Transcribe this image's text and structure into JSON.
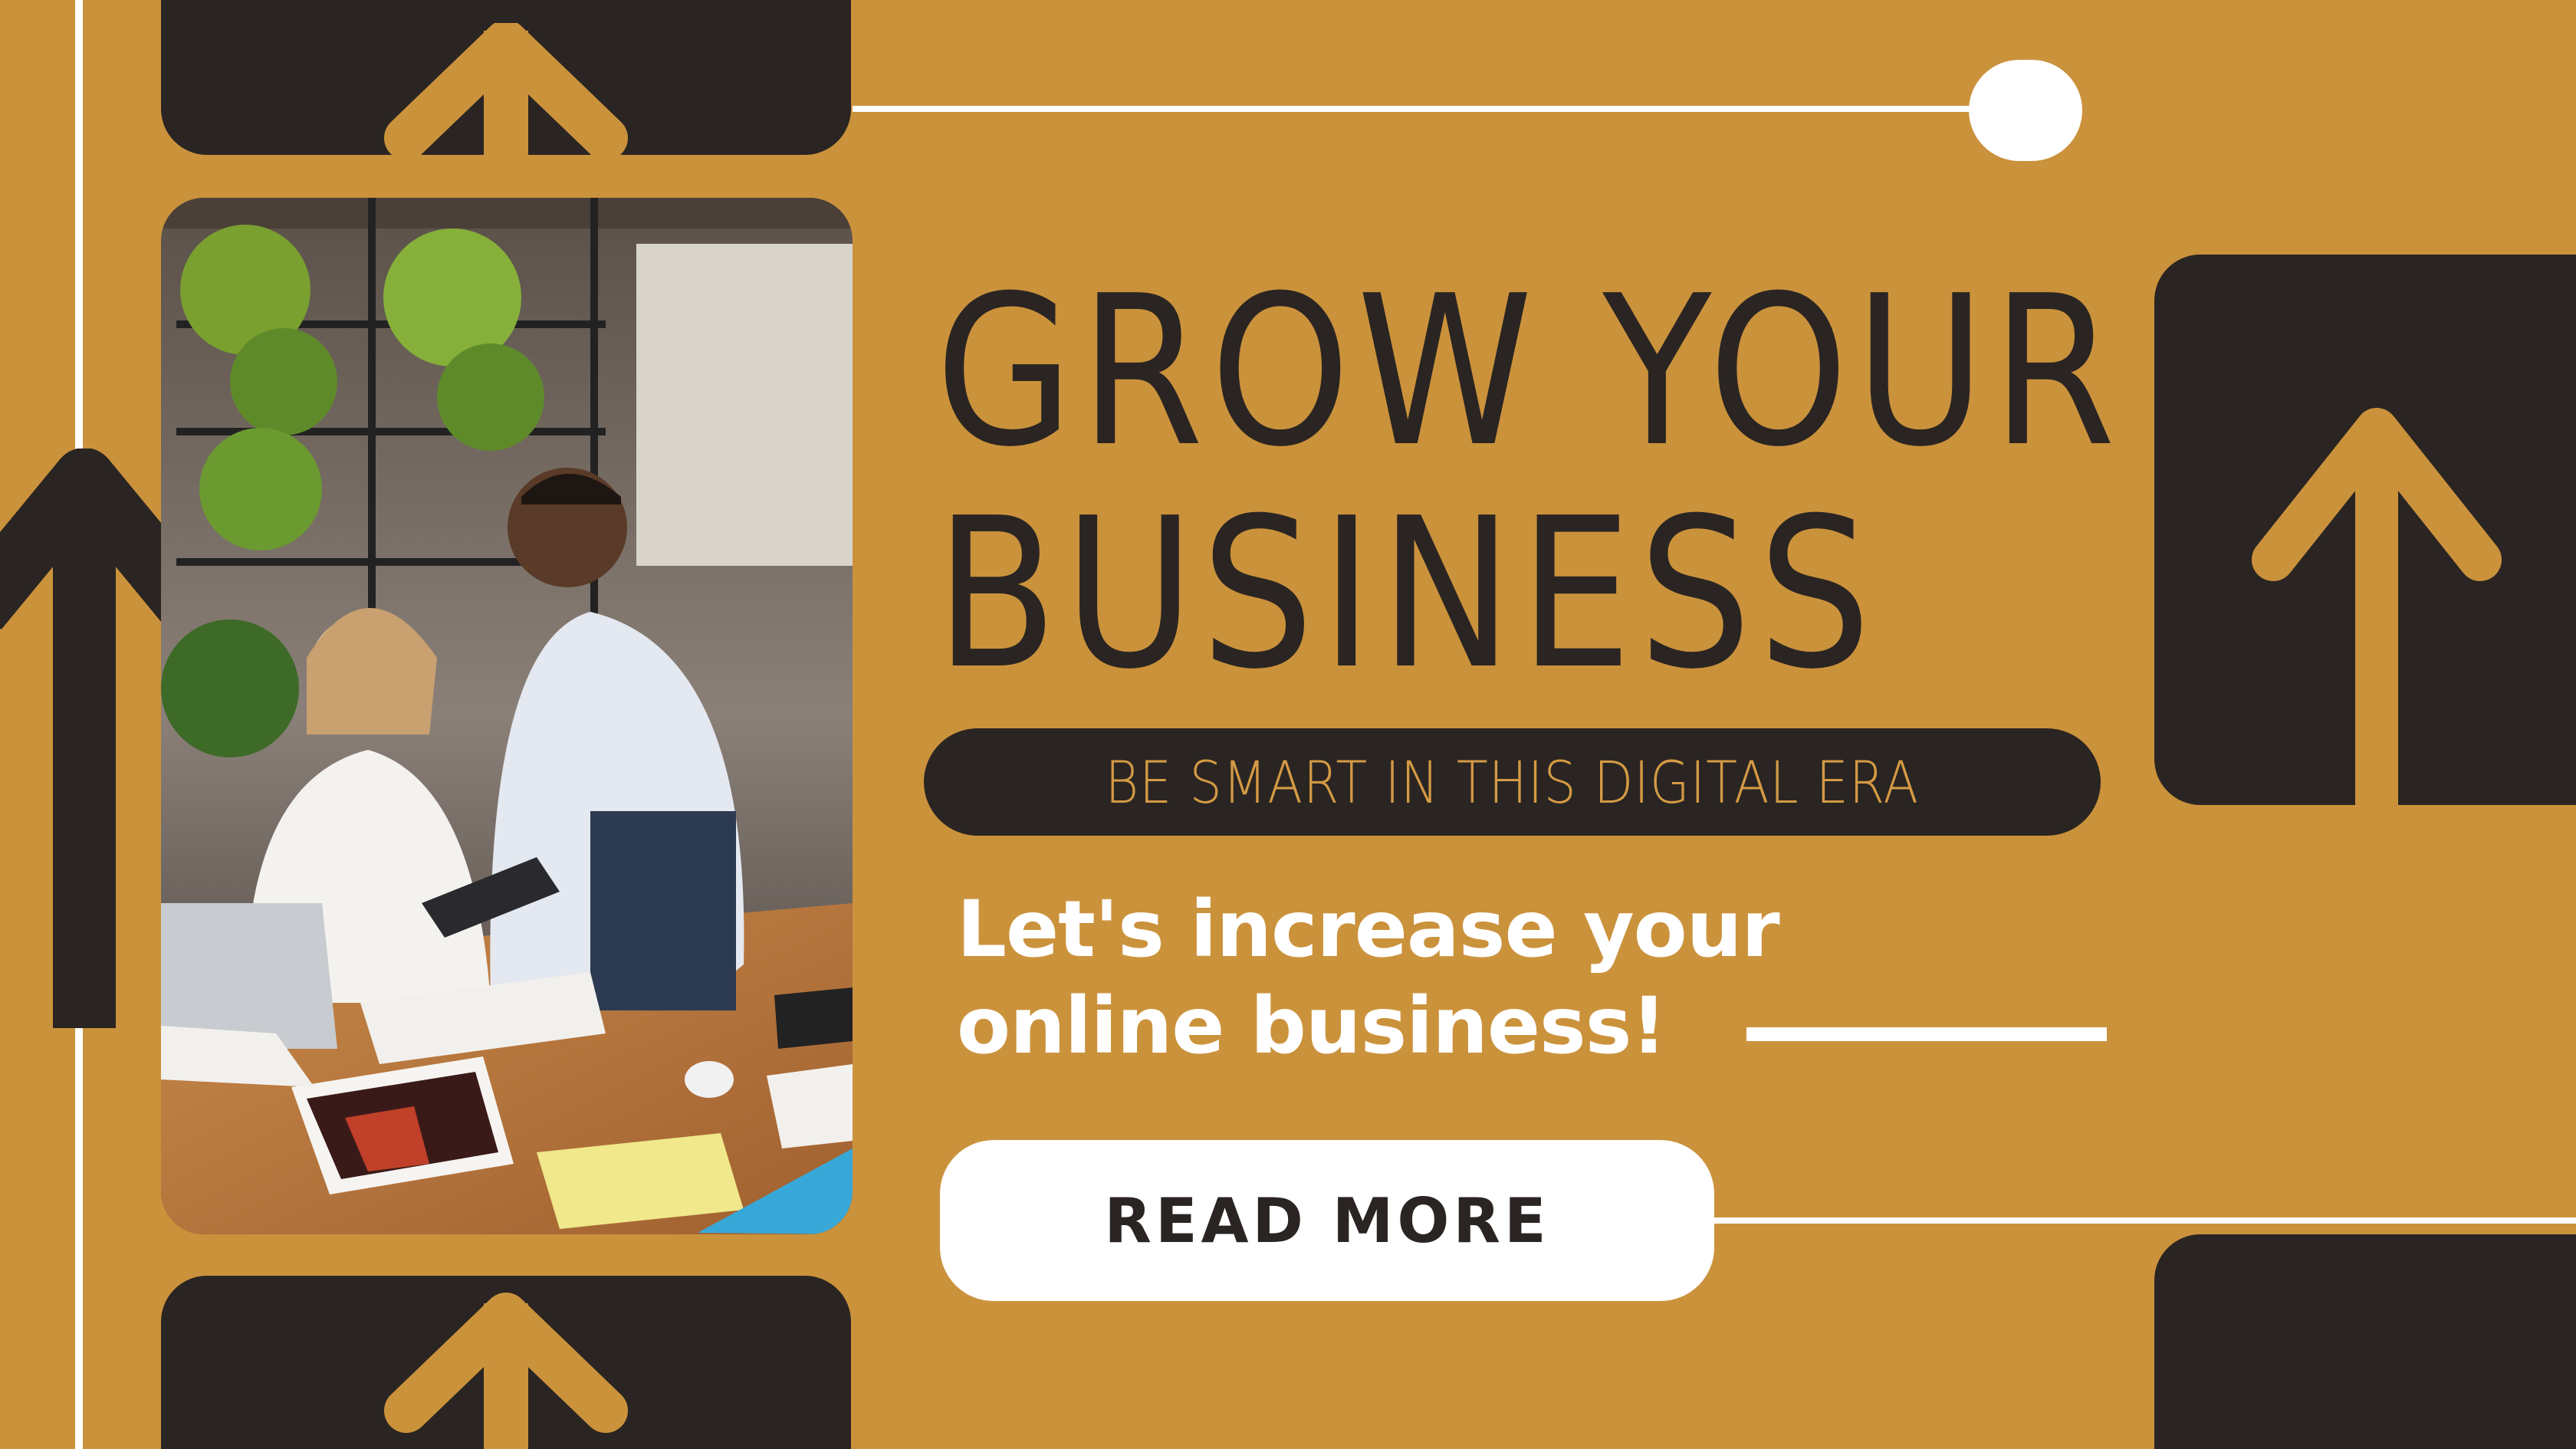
{
  "banner": {
    "headline_line1": "GROW YOUR",
    "headline_line2": "BUSINESS",
    "tagline": "BE SMART IN THIS DIGITAL ERA",
    "subtext_line1": "Let's increase your",
    "subtext_line2": "online business!",
    "cta_label": "READ MORE"
  },
  "colors": {
    "background": "#cb923c",
    "dark": "#2a2522",
    "accent_text": "#d49a44",
    "white": "#ffffff"
  },
  "icons": [
    "arrow-up-icon",
    "dot-icon"
  ],
  "photo": {
    "subject": "office-team-photo"
  }
}
